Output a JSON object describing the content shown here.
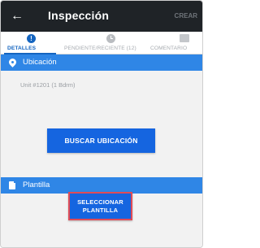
{
  "appbar": {
    "title": "Inspección",
    "action_label": "CREAR"
  },
  "tabs": [
    {
      "label": "DETALLES",
      "icon": "info-icon",
      "active": true
    },
    {
      "label": "PENDIENTE/RECIENTE (12)",
      "icon": "clock-icon",
      "active": false
    },
    {
      "label": "COMENTARIO",
      "icon": "comment-icon",
      "active": false
    }
  ],
  "location": {
    "header_label": "Ubicación",
    "icon": "pin-icon",
    "value": "Unit #1201 (1 Bdrm)",
    "button_label": "BUSCAR UBICACIÓN"
  },
  "template": {
    "header_label": "Plantilla",
    "icon": "document-icon",
    "button_line1": "SELECCIONAR",
    "button_line2": "PLANTILLA"
  },
  "colors": {
    "appbar": "#1f2327",
    "accent": "#1565c0",
    "section_header": "#2f86e6",
    "button": "#1565e0",
    "highlight_border": "#e04b56"
  }
}
